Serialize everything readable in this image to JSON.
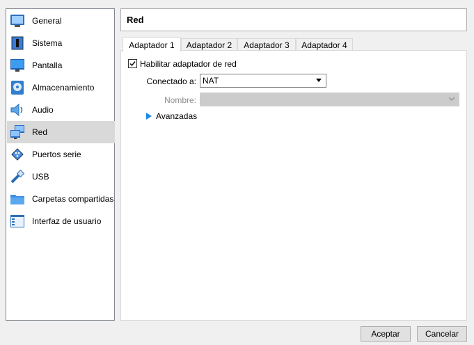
{
  "sidebar": {
    "items": [
      {
        "label": "General",
        "icon": "general-icon"
      },
      {
        "label": "Sistema",
        "icon": "system-icon"
      },
      {
        "label": "Pantalla",
        "icon": "display-icon"
      },
      {
        "label": "Almacenamiento",
        "icon": "storage-icon"
      },
      {
        "label": "Audio",
        "icon": "audio-icon"
      },
      {
        "label": "Red",
        "icon": "network-icon",
        "selected": true
      },
      {
        "label": "Puertos serie",
        "icon": "serial-ports-icon"
      },
      {
        "label": "USB",
        "icon": "usb-icon"
      },
      {
        "label": "Carpetas compartidas",
        "icon": "shared-folders-icon"
      },
      {
        "label": "Interfaz de usuario",
        "icon": "user-interface-icon"
      }
    ]
  },
  "header": {
    "title": "Red"
  },
  "tabs": [
    {
      "label": "Adaptador 1",
      "active": true
    },
    {
      "label": "Adaptador 2",
      "active": false
    },
    {
      "label": "Adaptador 3",
      "active": false
    },
    {
      "label": "Adaptador 4",
      "active": false
    }
  ],
  "adapter": {
    "enable_label": "Habilitar adaptador de red",
    "enable_checked": true,
    "attached_label": "Conectado a:",
    "attached_value": "NAT",
    "name_label": "Nombre:",
    "name_value": "",
    "advanced_label": "Avanzadas"
  },
  "buttons": {
    "ok": "Aceptar",
    "cancel": "Cancelar"
  },
  "colors": {
    "selected_bg": "#d9d9d9",
    "accent_blue": "#1e88e5"
  }
}
